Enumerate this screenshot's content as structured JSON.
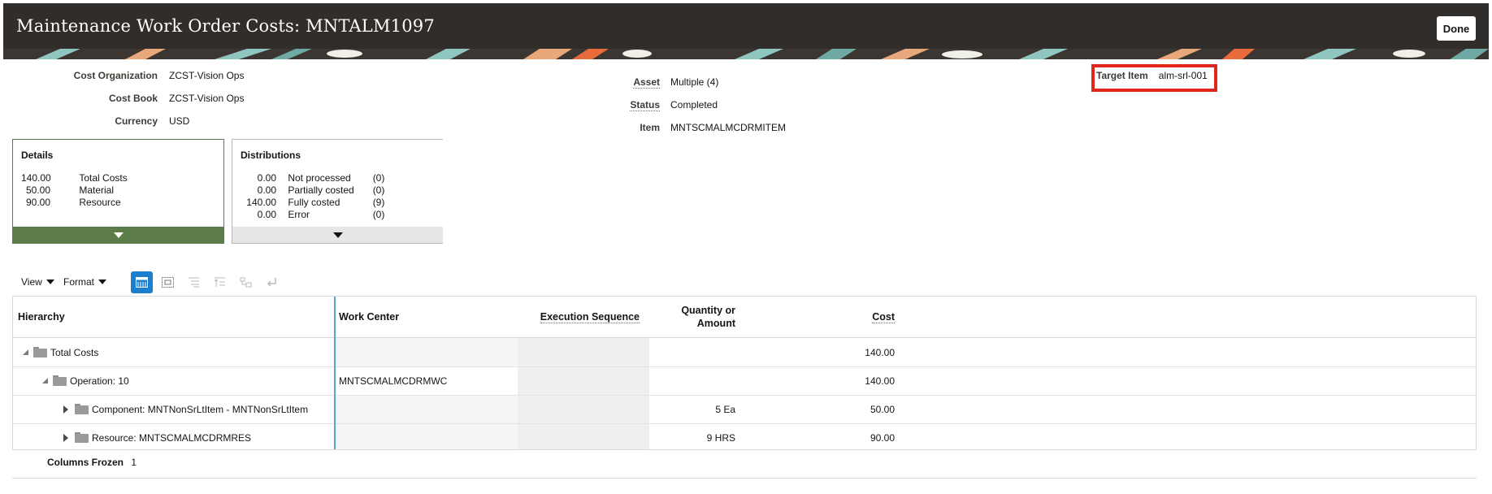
{
  "header": {
    "title": "Maintenance Work Order Costs: MNTALM1097",
    "done_label": "Done"
  },
  "summary_left": {
    "cost_org_label": "Cost Organization",
    "cost_org_value": "ZCST-Vision Ops",
    "cost_book_label": "Cost Book",
    "cost_book_value": "ZCST-Vision Ops",
    "currency_label": "Currency",
    "currency_value": "USD"
  },
  "summary_mid": {
    "asset_label": "Asset",
    "asset_value": "Multiple (4)",
    "status_label": "Status",
    "status_value": "Completed",
    "item_label": "Item",
    "item_value": "MNTSCMALMCDRMITEM"
  },
  "summary_right": {
    "target_item_label": "Target Item",
    "target_item_value": "alm-srl-001"
  },
  "details_tile": {
    "title": "Details",
    "rows": [
      {
        "amount": "140.00",
        "label": "Total Costs"
      },
      {
        "amount": "50.00",
        "label": "Material"
      },
      {
        "amount": "90.00",
        "label": "Resource"
      }
    ]
  },
  "distributions_tile": {
    "title": "Distributions",
    "rows": [
      {
        "amount": "0.00",
        "label": "Not processed",
        "count": "(0)"
      },
      {
        "amount": "0.00",
        "label": "Partially costed",
        "count": "(0)"
      },
      {
        "amount": "140.00",
        "label": "Fully costed",
        "count": "(9)"
      },
      {
        "amount": "0.00",
        "label": "Error",
        "count": "(0)"
      }
    ]
  },
  "toolbar": {
    "view_label": "View",
    "format_label": "Format",
    "icons": [
      "detach-icon",
      "freeze-icon",
      "expand-all-icon",
      "collapse-all-icon",
      "go-to-top-icon",
      "wrap-icon"
    ]
  },
  "table": {
    "headers": {
      "hierarchy": "Hierarchy",
      "work_center": "Work Center",
      "execution_sequence": "Execution Sequence",
      "quantity_line1": "Quantity or",
      "quantity_line2": "Amount",
      "cost": "Cost"
    },
    "rows": [
      {
        "hierarchy": "Total Costs",
        "work_center": "",
        "execution_sequence": "",
        "quantity": "",
        "cost": "140.00"
      },
      {
        "hierarchy": "Operation: 10",
        "work_center": "MNTSCMALMCDRMWC",
        "execution_sequence": "",
        "quantity": "",
        "cost": "140.00"
      },
      {
        "hierarchy": "Component: MNTNonSrLtItem - MNTNonSrLtItem",
        "work_center": "",
        "execution_sequence": "",
        "quantity": "5 Ea",
        "cost": "50.00"
      },
      {
        "hierarchy": "Resource: MNTSCMALMCDRMRES",
        "work_center": "",
        "execution_sequence": "",
        "quantity": "9 HRS",
        "cost": "90.00"
      }
    ]
  },
  "footer": {
    "columns_frozen_label": "Columns Frozen",
    "columns_frozen_value": "1"
  }
}
